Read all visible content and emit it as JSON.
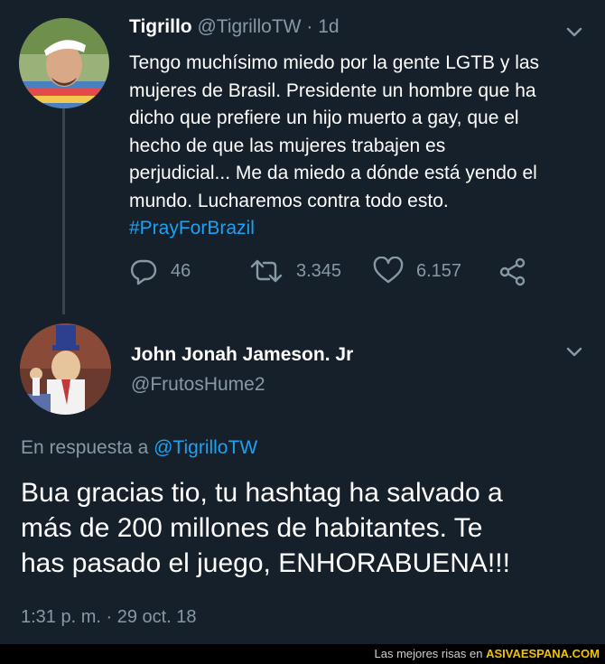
{
  "tweet": {
    "display_name": "Tigrillo",
    "handle": "@TigrilloTW",
    "separator": "·",
    "time_ago": "1d",
    "text_lines": [
      "Tengo muchísimo miedo por la gente LGTB y las",
      "mujeres de Brasil. Presidente un hombre que ha",
      "dicho que prefiere un hijo muerto a gay, que el",
      "hecho de que las mujeres trabajen es",
      "perjudicial... Me da miedo a dónde está yendo el",
      "mundo. Lucharemos contra todo esto."
    ],
    "hashtag": "#PrayForBrazil",
    "replies": "46",
    "retweets": "3.345",
    "likes": "6.157",
    "icons": [
      "reply-icon",
      "retweet-icon",
      "like-icon",
      "share-icon",
      "chevron-down-icon"
    ]
  },
  "reply": {
    "display_name": "John Jonah Jameson. Jr",
    "handle": "@FrutosHume2",
    "in_reply_prefix": "En respuesta a",
    "in_reply_handle": "@TigrilloTW",
    "text_lines": [
      "Bua gracias tio, tu hashtag ha salvado a",
      "más de 200 millones de habitantes. Te",
      "has pasado el juego, ENHORABUENA!!!"
    ],
    "timestamp": "1:31 p. m. · 29 oct. 18"
  },
  "footer": {
    "prefix": "Las mejores risas en",
    "brand": "ASIVAESPANA.COM"
  },
  "colors": {
    "background": "#15202b",
    "accent": "#1da1f2",
    "muted": "#8899a6",
    "thread_line": "#38444d"
  }
}
